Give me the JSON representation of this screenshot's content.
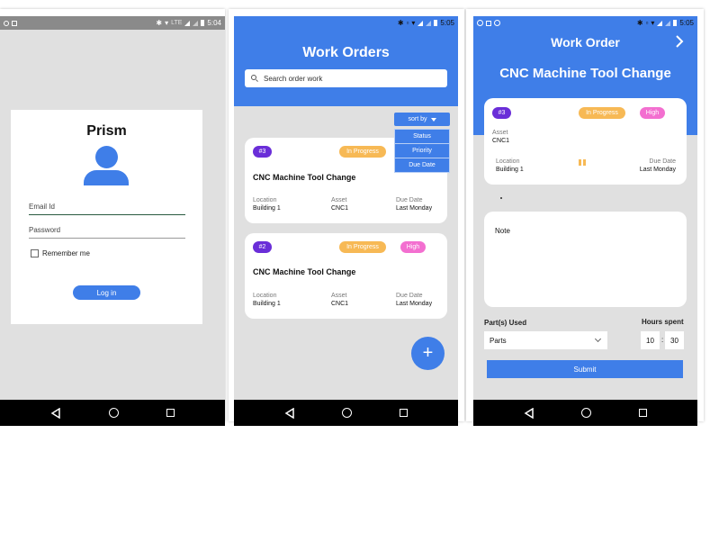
{
  "colors": {
    "primary": "#3f7ee8",
    "background": "#e0e0e0",
    "id_badge": "#6a2ed8",
    "in_progress_badge": "#f7b955",
    "high_badge": "#f36fd0",
    "nav_bar": "#000000"
  },
  "login_screen": {
    "status": {
      "time": "5:04",
      "network": "LTE"
    },
    "title": "Prism",
    "email_placeholder": "Email Id",
    "password_placeholder": "Password",
    "remember_label": "Remember me",
    "login_button": "Log in"
  },
  "list_screen": {
    "status": {
      "time": "5:05"
    },
    "title": "Work Orders",
    "search_placeholder": "Search order work",
    "sort_label": "sort by",
    "sort_options": [
      "Status",
      "Priority",
      "Due Date"
    ],
    "cards": [
      {
        "id": "#3",
        "status": "In Progress",
        "title": "CNC Machine Tool Change",
        "location_label": "Location",
        "location": "Building 1",
        "asset_label": "Asset",
        "asset": "CNC1",
        "due_label": "Due Date",
        "due": "Last Monday"
      },
      {
        "id": "#2",
        "status": "In Progress",
        "priority": "High",
        "title": "CNC Machine Tool Change",
        "location_label": "Location",
        "location": "Building 1",
        "asset_label": "Asset",
        "asset": "CNC1",
        "due_label": "Due Date",
        "due": "Last Monday"
      }
    ],
    "fab_label": "+"
  },
  "detail_screen": {
    "status": {
      "time": "5:05"
    },
    "title": "Work Order",
    "subtitle": "CNC Machine Tool Change",
    "id": "#3",
    "status_badge": "In Progress",
    "priority": "High",
    "asset_label": "Asset",
    "asset": "CNC1",
    "location_label": "Location",
    "location": "Building 1",
    "due_label": "Due Date",
    "due": "Last Monday",
    "note_label": "Note",
    "parts_label": "Part(s) Used",
    "parts_value": "Parts",
    "hours_label": "Hours spent",
    "hours": "10",
    "minutes": "30",
    "submit": "Submit"
  }
}
